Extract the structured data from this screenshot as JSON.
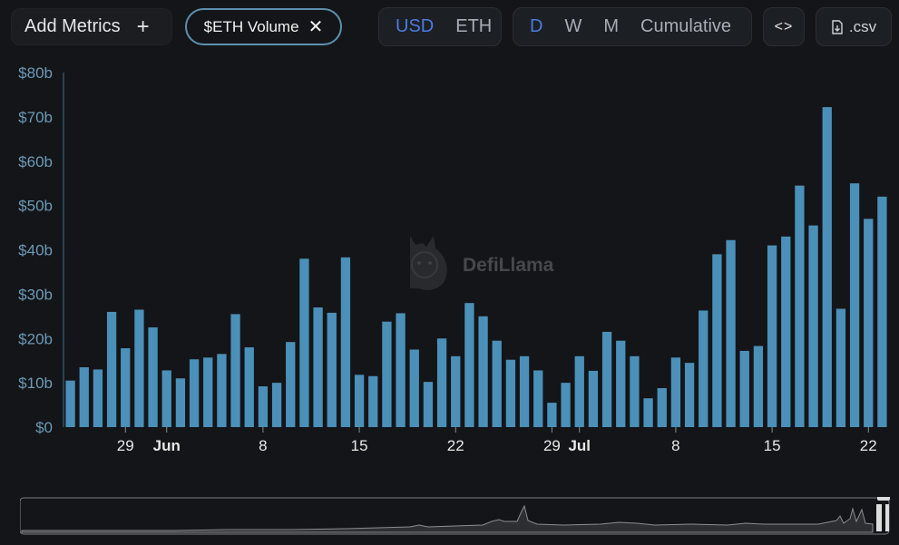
{
  "toolbar": {
    "add_metrics_label": "Add Metrics",
    "add_icon": "plus-icon",
    "metric_chip_label": "$ETH Volume",
    "remove_icon": "close-icon",
    "currency_options": [
      "USD",
      "ETH"
    ],
    "currency_selected": "USD",
    "period_options": [
      "D",
      "W",
      "M",
      "Cumulative"
    ],
    "period_selected": "D",
    "embed_icon": "code-icon",
    "csv_label": ".csv",
    "csv_icon": "download-icon"
  },
  "watermark": {
    "text": "DefiLlama",
    "icon": "llama-logo-icon"
  },
  "colors": {
    "bar": "#4b90b8",
    "axis_tick": "#6b9ab8",
    "active_option": "#4d7be0",
    "background": "#141518"
  },
  "chart_data": {
    "type": "bar",
    "series": [
      {
        "values": [
          10.5,
          13.5,
          13,
          26,
          17.8,
          26.5,
          22.5,
          12.8,
          11,
          15.3,
          15.7,
          16.5,
          25.5,
          18,
          9.2,
          10,
          19.2,
          38,
          27,
          25.8,
          38.3,
          11.8,
          11.5,
          23.8,
          25.7,
          17.5,
          10.2,
          20,
          16,
          28,
          25,
          19.5,
          15.2,
          16,
          12.8,
          5.5,
          10,
          16,
          12.7,
          21.5,
          19.5,
          16,
          6.5,
          8.8,
          15.7,
          14.5,
          26.3,
          39,
          42.2,
          17.2,
          18.3,
          41,
          43,
          54.5,
          45.5,
          72.2,
          26.7,
          55,
          47,
          52
        ]
      }
    ],
    "ylim": [
      0,
      80
    ],
    "yticks": [
      "$0",
      "$10b",
      "$20b",
      "$30b",
      "$40b",
      "$50b",
      "$60b",
      "$70b",
      "$80b"
    ],
    "xticks": [
      {
        "label": "29",
        "bar_index": 4,
        "month": false
      },
      {
        "label": "Jun",
        "bar_index": 7,
        "month": true
      },
      {
        "label": "8",
        "bar_index": 14,
        "month": false
      },
      {
        "label": "15",
        "bar_index": 21,
        "month": false
      },
      {
        "label": "22",
        "bar_index": 28,
        "month": false
      },
      {
        "label": "29",
        "bar_index": 35,
        "month": false
      },
      {
        "label": "Jul",
        "bar_index": 37,
        "month": true
      },
      {
        "label": "8",
        "bar_index": 44,
        "month": false
      },
      {
        "label": "15",
        "bar_index": 51,
        "month": false
      },
      {
        "label": "22",
        "bar_index": 58,
        "month": false
      }
    ],
    "grid": false
  }
}
